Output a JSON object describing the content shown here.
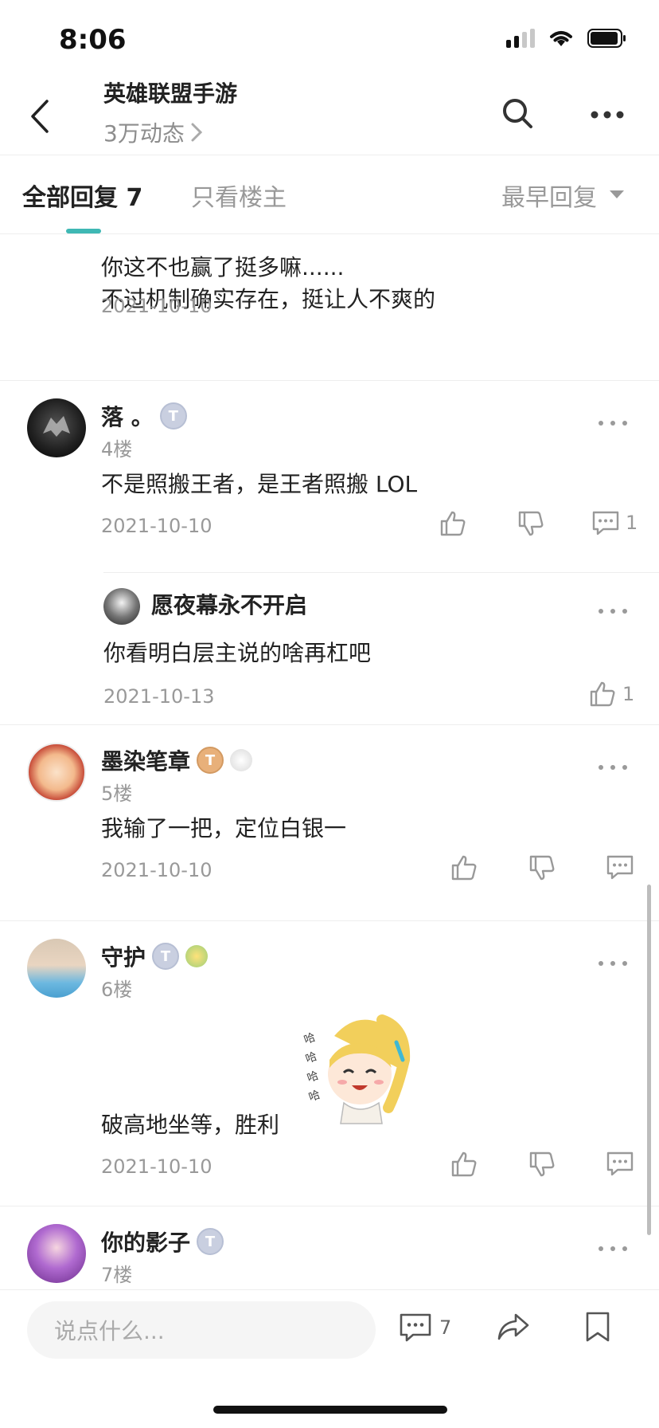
{
  "status": {
    "time": "8:06"
  },
  "header": {
    "title": "英雄联盟手游",
    "subtitle": "3万动态"
  },
  "tabs": {
    "all": "全部回复 7",
    "owner_only": "只看楼主",
    "sort": "最早回复"
  },
  "posts": [
    {
      "content_line1": "你这不也赢了挺多嘛......",
      "content_line2": "不过机制确实存在，挺让人不爽的",
      "date": "2021-10-10"
    },
    {
      "name": "落 。",
      "badge": "T",
      "floor": "4楼",
      "content": "不是照搬王者，是王者照搬 LOL",
      "date": "2021-10-10",
      "reply_count": "1",
      "reply": {
        "name": "愿夜幕永不开启",
        "content": "你看明白层主说的啥再杠吧",
        "date": "2021-10-13",
        "like_count": "1"
      }
    },
    {
      "name": "墨染笔章",
      "badge": "T",
      "floor": "5楼",
      "content": "我输了一把，定位白银一",
      "date": "2021-10-10"
    },
    {
      "name": "守护",
      "badge": "T",
      "floor": "6楼",
      "content": "破高地坐等，胜利",
      "date": "2021-10-10"
    },
    {
      "name": "你的影子",
      "badge": "T",
      "floor": "7楼"
    }
  ],
  "bottom": {
    "placeholder": "说点什么...",
    "comment_count": "7"
  },
  "colors": {
    "accent": "#3fb8b4",
    "muted": "#999999"
  }
}
